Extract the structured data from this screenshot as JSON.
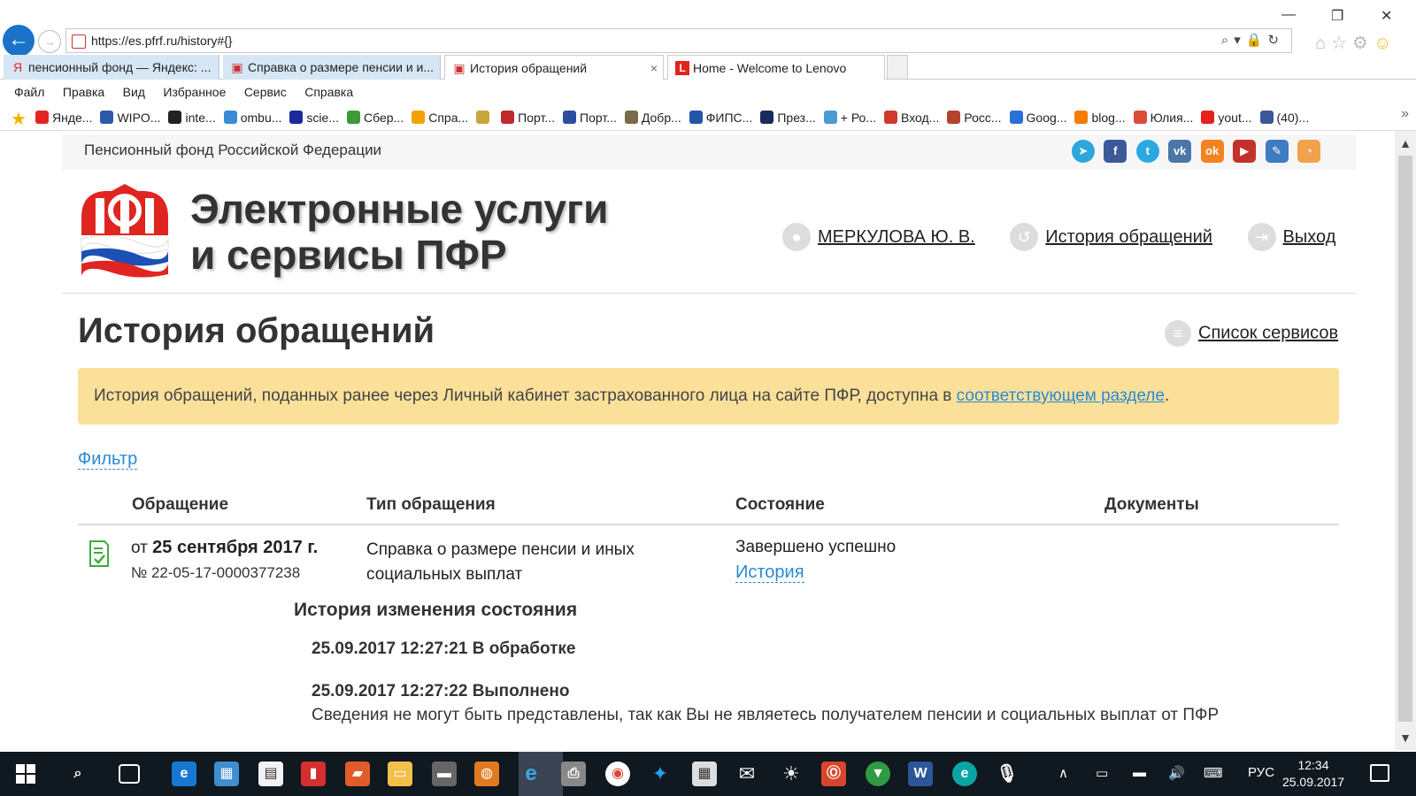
{
  "browser": {
    "url": "https://es.pfrf.ru/history#{}",
    "tabs": [
      {
        "label": "пенсионный фонд — Яндекс: ...",
        "icon": "Я"
      },
      {
        "label": "Справка о размере пенсии и и...",
        "icon": "▣"
      },
      {
        "label": "История обращений",
        "icon": "▣",
        "close": "×"
      },
      {
        "label": "Home - Welcome to Lenovo",
        "icon": "L"
      }
    ],
    "menu": [
      "Файл",
      "Правка",
      "Вид",
      "Избранное",
      "Сервис",
      "Справка"
    ],
    "favorites": [
      "Янде...",
      "WIPO...",
      "inte...",
      "ombu...",
      "scie...",
      "Сбер...",
      "Спра...",
      "",
      "Порт...",
      "Порт...",
      "Добр...",
      "ФИПС...",
      "През...",
      "+ Ро...",
      "Вход...",
      "Росс...",
      "Goog...",
      "blog...",
      "Юлия...",
      "yout...",
      "(40)..."
    ],
    "favorite_colors": [
      "#e52620",
      "#2a5aa8",
      "#222",
      "#3a8bd4",
      "#1c2a9c",
      "#3d9a3d",
      "#f4a200",
      "#c9a63a",
      "#c0282d",
      "#2b4ea3",
      "#7a6a4a",
      "#2255aa",
      "#1a2a5a",
      "#4a9ad4",
      "#d03a2e",
      "#b3432e",
      "#2c6fd8",
      "#f57c00",
      "#dd4b39",
      "#e62117",
      "#3b5998"
    ]
  },
  "page": {
    "org_name": "Пенсионный фонд Российской Федерации",
    "title_line1": "Электронные услуги",
    "title_line2": "и сервисы ПФР",
    "user_name": "МЕРКУЛОВА Ю. В.",
    "history_link": "История обращений",
    "logout": "Выход",
    "heading": "История обращений",
    "services_link": "Список сервисов",
    "notice_text": "История обращений, поданных ранее через Личный кабинет застрахованного лица на сайте ПФР, доступна в ",
    "notice_link": "соответствующем разделе",
    "notice_end": ".",
    "filter": "Фильтр",
    "columns": [
      "Обращение",
      "Тип обращения",
      "Состояние",
      "Документы"
    ],
    "row": {
      "date_prefix": "от",
      "date": "25 сентября 2017 г.",
      "number": "№ 22-05-17-0000377238",
      "type": "Справка о размере пенсии и иных социальных выплат",
      "status": "Завершено успешно",
      "history": "История"
    },
    "history": {
      "title": "История изменения состояния",
      "entries": [
        "25.09.2017 12:27:21 В обработке",
        "25.09.2017 12:27:22 Выполнено"
      ],
      "note": "Сведения не могут быть представлены, так как Вы не являетесь получателем пенсии и социальных выплат от ПФР"
    }
  },
  "taskbar": {
    "language": "РУС",
    "time": "12:34",
    "date": "25.09.2017"
  },
  "colors": {
    "accent": "#2a8ad2",
    "notice_bg": "#fbe09a",
    "taskbar": "#101820"
  }
}
